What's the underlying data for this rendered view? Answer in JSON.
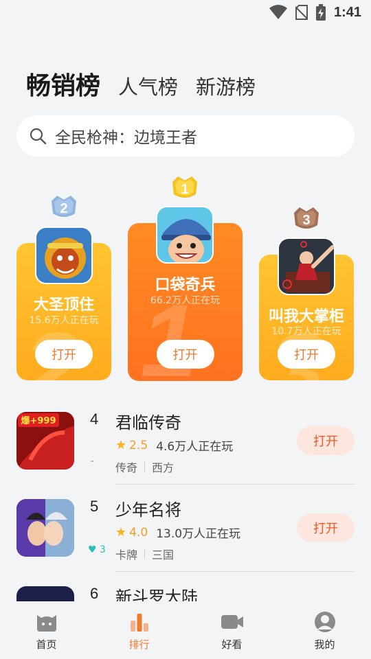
{
  "status_bar": {
    "time": "1:41"
  },
  "tabs": [
    {
      "label": "畅销榜",
      "active": true
    },
    {
      "label": "人气榜",
      "active": false
    },
    {
      "label": "新游榜",
      "active": false
    }
  ],
  "search": {
    "placeholder": "全民枪神：边境王者"
  },
  "podium": [
    {
      "rank": "1",
      "name": "口袋奇兵",
      "players": "66.2万人正在玩",
      "open_label": "打开"
    },
    {
      "rank": "2",
      "name": "大圣顶住",
      "players": "15.6万人正在玩",
      "open_label": "打开"
    },
    {
      "rank": "3",
      "name": "叫我大掌柜",
      "players": "10.7万人正在玩",
      "open_label": "打开"
    }
  ],
  "list": [
    {
      "rank": "4",
      "name": "君临传奇",
      "score": "2.5",
      "players": "4.6万人正在玩",
      "tags": [
        "传奇",
        "西方"
      ],
      "trend": "-",
      "open_label": "打开",
      "icon_text": "爆+999"
    },
    {
      "rank": "5",
      "name": "少年名将",
      "score": "4.0",
      "players": "13.0万人正在玩",
      "tags": [
        "卡牌",
        "三国"
      ],
      "trend": "3",
      "open_label": "打开"
    },
    {
      "rank": "6",
      "name": "新斗罗大陆"
    }
  ],
  "bottom_nav": [
    {
      "label": "首页",
      "active": false,
      "icon": "cat-icon"
    },
    {
      "label": "排行",
      "active": true,
      "icon": "bar-chart-icon"
    },
    {
      "label": "好看",
      "active": false,
      "icon": "video-icon"
    },
    {
      "label": "我的",
      "active": false,
      "icon": "person-icon"
    }
  ],
  "colors": {
    "accent": "#f07a2a",
    "gold": "#ffb11a",
    "orange": "#ff7f22",
    "teal": "#2bbfb8"
  }
}
